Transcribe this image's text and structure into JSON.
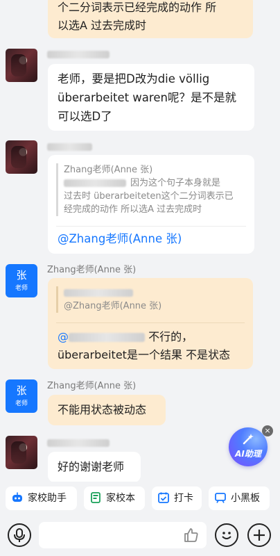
{
  "messages": {
    "m0": {
      "line1": "个二分词表示已经完成的动作 所",
      "line2": "以选A 过去完成时"
    },
    "m1": {
      "line1": "老师，要是把D改为die völlig",
      "line2": "überarbeitet waren呢？是不是就",
      "line3": "可以选D了"
    },
    "m2": {
      "quote_author": "Zhang老师(Anne 张)",
      "quote_line1": "因为这个句子本身就是",
      "quote_line2": "过去时 überarbeiteten这个二分词表示已",
      "quote_line3": "经完成的动作 所以选A 过去完成时",
      "mention": "@Zhang老师(Anne 张)"
    },
    "m3": {
      "sender": "Zhang老师(Anne 张)",
      "quote_line1": "@Zhang老师(Anne 张)",
      "reply_line1": "不行的，",
      "reply_line2": "überarbeitet是一个结果 不是状态"
    },
    "m4": {
      "sender": "Zhang老师(Anne 张)",
      "text": "不能用状态被动态"
    },
    "m5": {
      "text": "好的谢谢老师"
    }
  },
  "teacher_avatar": {
    "char": "张",
    "role": "老师"
  },
  "ai_assistant": {
    "label": "AI助理",
    "close": "×"
  },
  "quickbar": {
    "items": [
      {
        "label": "家校助手",
        "icon": "robot-icon"
      },
      {
        "label": "家校本",
        "icon": "notebook-icon"
      },
      {
        "label": "打卡",
        "icon": "checkin-icon"
      },
      {
        "label": "小黑板",
        "icon": "blackboard-icon"
      }
    ]
  },
  "input": {
    "placeholder": ""
  },
  "colors": {
    "accent": "#1677ff",
    "orange_bubble": "#fdebd0",
    "background": "#f2f3f5"
  }
}
